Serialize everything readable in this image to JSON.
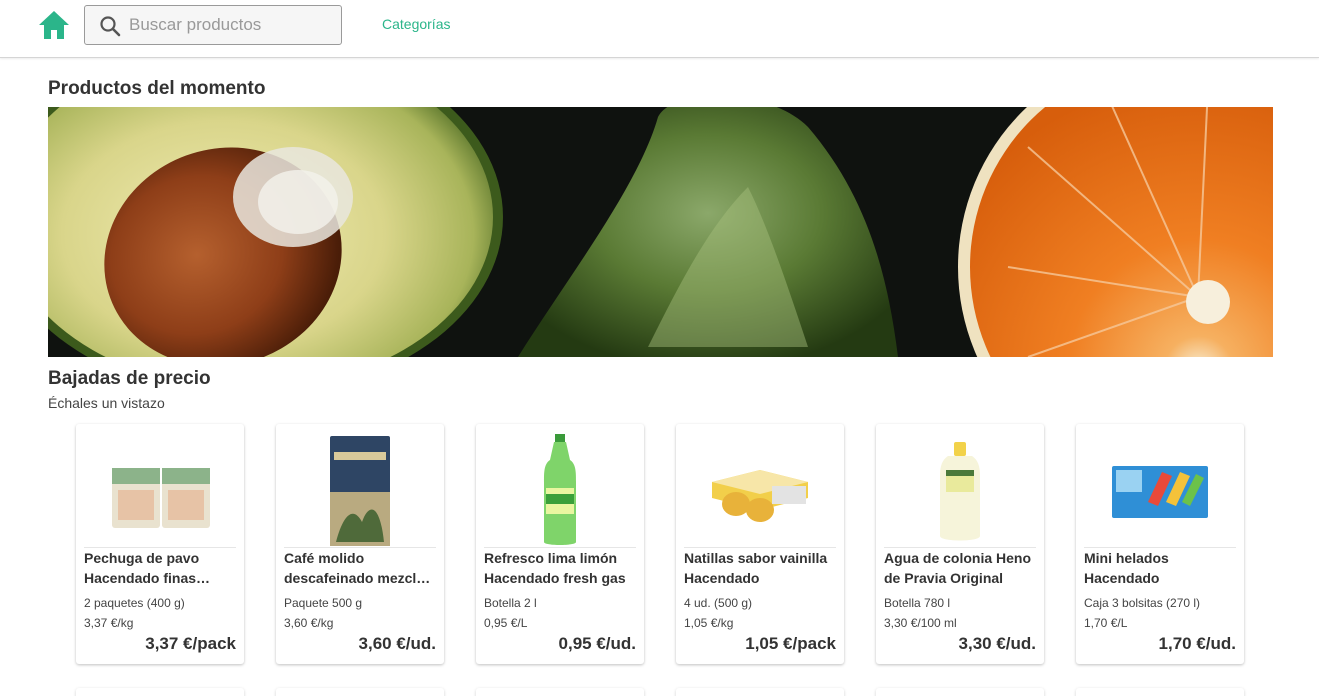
{
  "header": {
    "search_placeholder": "Buscar productos",
    "categories_label": "Categorías",
    "accent_color": "#2bb58a"
  },
  "featured": {
    "title": "Productos del momento"
  },
  "price_drops": {
    "title": "Bajadas de precio",
    "subtitle": "Échales un vistazo",
    "products": [
      {
        "name": "Pechuga de pavo Hacendado finas lonchas",
        "format": "2 paquetes (400 g)",
        "unit_price": "3,37 €/kg",
        "price": "3,37 €/pack"
      },
      {
        "name": "Café molido descafeinado mezcla Hacendado",
        "format": "Paquete 500 g",
        "unit_price": "3,60 €/kg",
        "price": "3,60 €/ud."
      },
      {
        "name": "Refresco lima limón Hacendado fresh gas",
        "format": "Botella 2 l",
        "unit_price": "0,95 €/L",
        "price": "0,95 €/ud."
      },
      {
        "name": "Natillas sabor vainilla Hacendado",
        "format": "4 ud. (500 g)",
        "unit_price": "1,05 €/kg",
        "price": "1,05 €/pack"
      },
      {
        "name": "Agua de colonia Heno de Pravia Original",
        "format": "Botella 780 l",
        "unit_price": "3,30 €/100 ml",
        "price": "3,30 €/ud."
      },
      {
        "name": "Mini helados Hacendado",
        "format": "Caja 3 bolsitas (270 l)",
        "unit_price": "1,70 €/L",
        "price": "1,70 €/ud."
      }
    ]
  }
}
